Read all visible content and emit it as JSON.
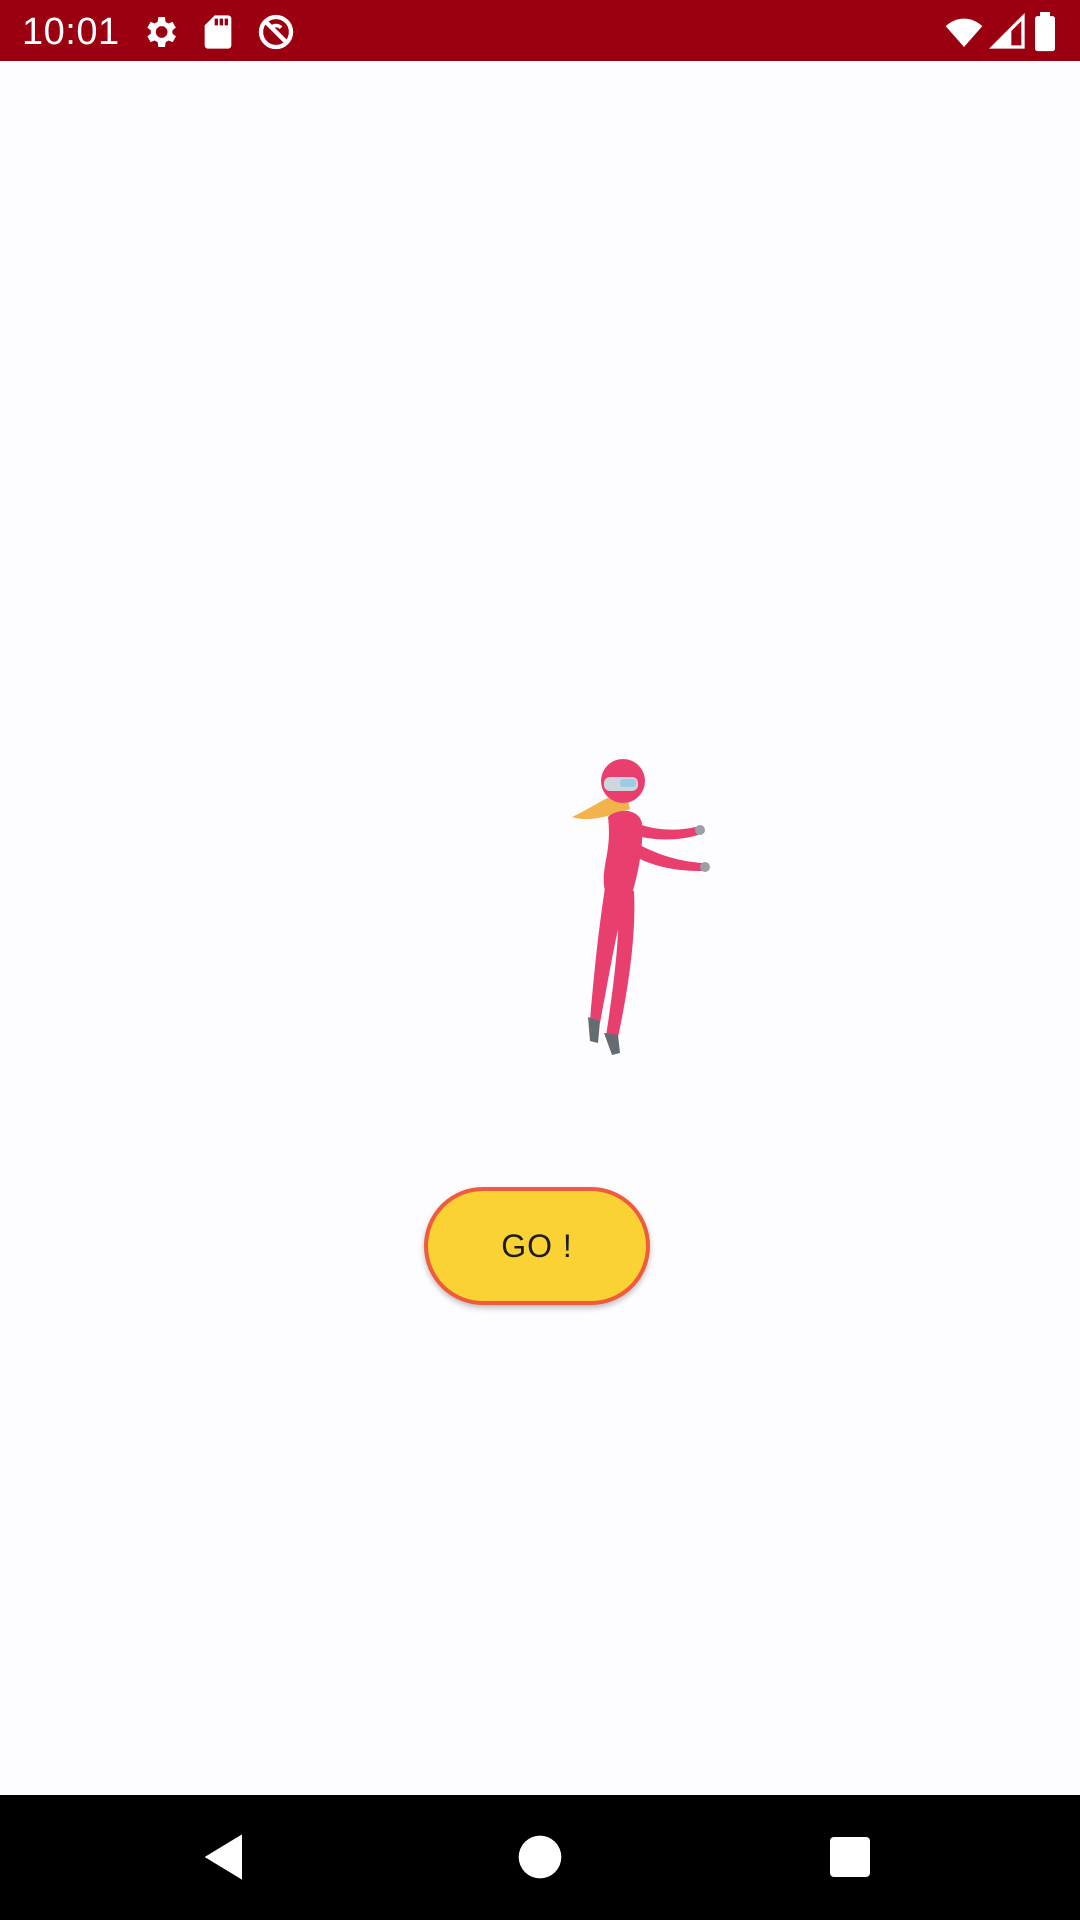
{
  "status_bar": {
    "time": "10:01",
    "background_color": "#9b0010",
    "left_icons": [
      "gear-icon",
      "sd-card-icon",
      "no-sync-icon"
    ],
    "right_icons": [
      "wifi-icon",
      "cell-signal-icon",
      "battery-icon"
    ]
  },
  "main": {
    "illustration": "skydiver-illustration",
    "go_button": {
      "label": "GO !",
      "fill_color": "#fbd234",
      "border_color": "#ef5b3c"
    }
  },
  "nav_bar": {
    "buttons": [
      "back-icon",
      "home-icon",
      "recents-icon"
    ]
  }
}
